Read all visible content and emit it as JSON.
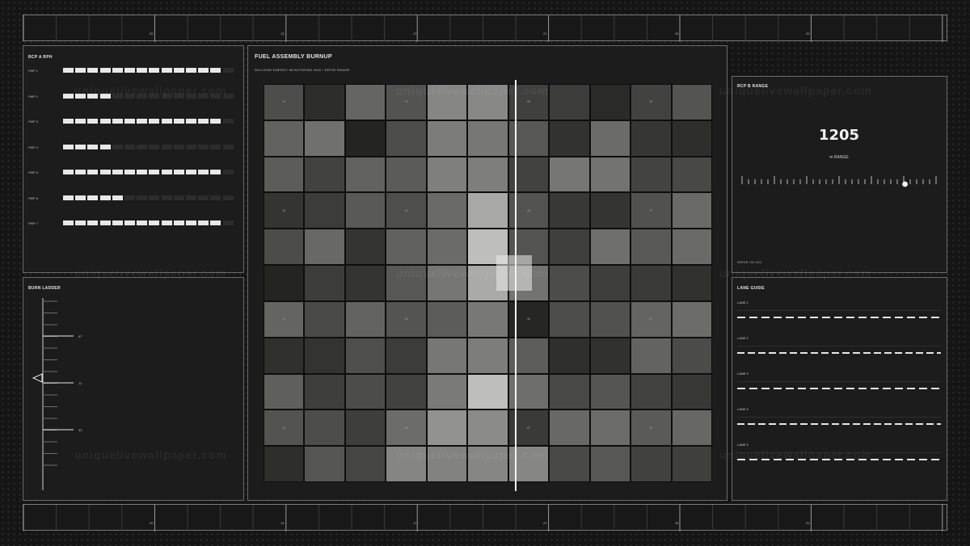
{
  "ruler": {
    "labels": [
      "20",
      "13",
      "17",
      "21",
      "25",
      "29"
    ]
  },
  "pump_panel": {
    "title": "RCP A  RPH",
    "pumps": [
      {
        "label": "PMP 1",
        "level": 0.93
      },
      {
        "label": "PMP 2",
        "level": 0.29
      },
      {
        "label": "PMP 3",
        "level": 0.93
      },
      {
        "label": "PMP 4",
        "level": 0.29
      },
      {
        "label": "PMP 5",
        "level": 0.93
      },
      {
        "label": "PMP 6",
        "level": 0.36
      },
      {
        "label": "PMP 7",
        "level": 0.93
      }
    ]
  },
  "ladder": {
    "title": "BURN LADDER",
    "labels": [
      "87",
      "11",
      "33"
    ]
  },
  "fuel": {
    "title": "FUEL ASSEMBLY BURNUP",
    "subtitle": "NUCLEAR ENERGY MONITORING HUD  /  DRIVE RANGE",
    "cols": 11,
    "rows": 11,
    "shades": [
      [
        77,
        45,
        101,
        83,
        134,
        136,
        64,
        60,
        42,
        66,
        84
      ],
      [
        98,
        112,
        36,
        77,
        124,
        119,
        87,
        50,
        107,
        54,
        46
      ],
      [
        92,
        66,
        98,
        91,
        127,
        126,
        66,
        118,
        115,
        67,
        72
      ],
      [
        52,
        60,
        89,
        78,
        106,
        168,
        83,
        56,
        52,
        81,
        106
      ],
      [
        76,
        104,
        52,
        97,
        107,
        190,
        84,
        63,
        111,
        89,
        106
      ],
      [
        36,
        61,
        52,
        88,
        118,
        170,
        115,
        76,
        62,
        58,
        49
      ],
      [
        100,
        74,
        99,
        84,
        92,
        120,
        38,
        77,
        81,
        100,
        108
      ],
      [
        48,
        51,
        78,
        60,
        119,
        125,
        93,
        47,
        49,
        99,
        75
      ],
      [
        95,
        62,
        76,
        66,
        122,
        190,
        110,
        73,
        85,
        66,
        56
      ],
      [
        83,
        77,
        62,
        108,
        146,
        139,
        58,
        104,
        108,
        90,
        103
      ],
      [
        46,
        86,
        69,
        133,
        130,
        134,
        134,
        73,
        87,
        65,
        63
      ]
    ],
    "labels": [
      {
        "row": 0,
        "col": 0,
        "text": "12"
      },
      {
        "row": 0,
        "col": 3,
        "text": "22"
      },
      {
        "row": 0,
        "col": 6,
        "text": "08"
      },
      {
        "row": 0,
        "col": 9,
        "text": "30"
      },
      {
        "row": 3,
        "col": 0,
        "text": "15"
      },
      {
        "row": 3,
        "col": 3,
        "text": "24"
      },
      {
        "row": 3,
        "col": 6,
        "text": "10"
      },
      {
        "row": 3,
        "col": 9,
        "text": "17"
      },
      {
        "row": 6,
        "col": 0,
        "text": "11"
      },
      {
        "row": 6,
        "col": 3,
        "text": "29"
      },
      {
        "row": 6,
        "col": 6,
        "text": "36"
      },
      {
        "row": 6,
        "col": 9,
        "text": "21"
      },
      {
        "row": 9,
        "col": 0,
        "text": "12"
      },
      {
        "row": 9,
        "col": 3,
        "text": "05"
      },
      {
        "row": 9,
        "col": 6,
        "text": "07"
      },
      {
        "row": 9,
        "col": 9,
        "text": "03"
      }
    ],
    "cursor_fraction": 0.56
  },
  "range_panel": {
    "title": "RCP B  RANGE",
    "value": "1205",
    "unit": "m   RANGE",
    "slider_level": 0.84,
    "footer": "DRIVE CK-041"
  },
  "lane_panel": {
    "title": "LANE GUIDE",
    "lanes": [
      {
        "label": "LANE 1"
      },
      {
        "label": "LANE 2"
      },
      {
        "label": "LANE 3"
      },
      {
        "label": "LANE 4"
      },
      {
        "label": "LANE 5"
      }
    ]
  },
  "watermark": "uniquelivewallpaper.com"
}
